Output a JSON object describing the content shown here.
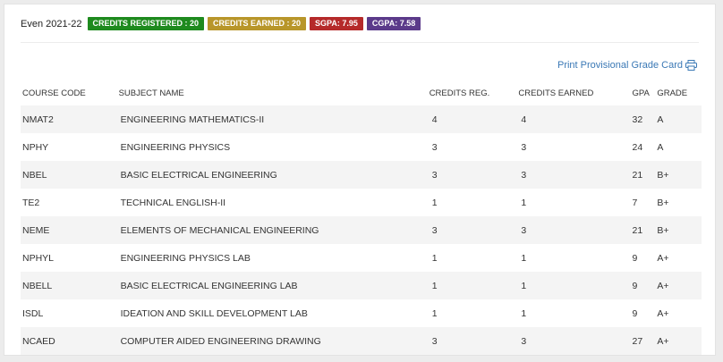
{
  "semester": {
    "label": "Even 2021-22",
    "badges": [
      {
        "text": "CREDITS REGISTERED : 20",
        "color": "#1e8a1e"
      },
      {
        "text": "CREDITS EARNED : 20",
        "color": "#b8962a"
      },
      {
        "text": "SGPA: 7.95",
        "color": "#b52a2a"
      },
      {
        "text": "CGPA: 7.58",
        "color": "#5b3a8a"
      }
    ]
  },
  "print": {
    "label": "Print Provisional Grade Card",
    "icon": "printer-icon",
    "color": "#3a78b5"
  },
  "table": {
    "headers": [
      "COURSE CODE",
      "SUBJECT NAME",
      "CREDITS REG.",
      "CREDITS EARNED",
      "GPA",
      "GRADE"
    ],
    "rows": [
      {
        "code": "NMAT2",
        "subject": "ENGINEERING MATHEMATICS-II",
        "reg": "4",
        "earned": "4",
        "gpa": "32",
        "grade": "A"
      },
      {
        "code": "NPHY",
        "subject": "ENGINEERING PHYSICS",
        "reg": "3",
        "earned": "3",
        "gpa": "24",
        "grade": "A"
      },
      {
        "code": "NBEL",
        "subject": "BASIC ELECTRICAL ENGINEERING",
        "reg": "3",
        "earned": "3",
        "gpa": "21",
        "grade": "B+"
      },
      {
        "code": "TE2",
        "subject": "TECHNICAL ENGLISH-II",
        "reg": "1",
        "earned": "1",
        "gpa": "7",
        "grade": "B+"
      },
      {
        "code": "NEME",
        "subject": "ELEMENTS OF MECHANICAL ENGINEERING",
        "reg": "3",
        "earned": "3",
        "gpa": "21",
        "grade": "B+"
      },
      {
        "code": "NPHYL",
        "subject": "ENGINEERING PHYSICS LAB",
        "reg": "1",
        "earned": "1",
        "gpa": "9",
        "grade": "A+"
      },
      {
        "code": "NBELL",
        "subject": "BASIC ELECTRICAL ENGINEERING LAB",
        "reg": "1",
        "earned": "1",
        "gpa": "9",
        "grade": "A+"
      },
      {
        "code": "ISDL",
        "subject": "IDEATION AND SKILL DEVELOPMENT LAB",
        "reg": "1",
        "earned": "1",
        "gpa": "9",
        "grade": "A+"
      },
      {
        "code": "NCAED",
        "subject": "COMPUTER AIDED ENGINEERING DRAWING",
        "reg": "3",
        "earned": "3",
        "gpa": "27",
        "grade": "A+"
      }
    ]
  }
}
